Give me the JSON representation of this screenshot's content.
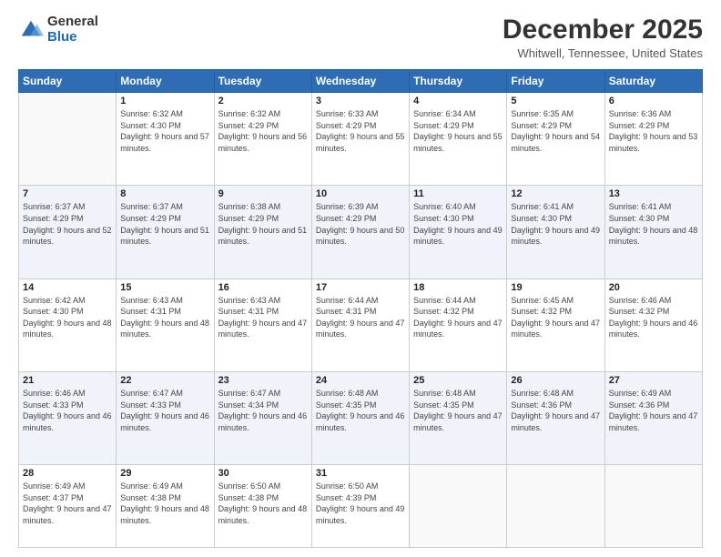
{
  "header": {
    "logo_general": "General",
    "logo_blue": "Blue",
    "month_title": "December 2025",
    "location": "Whitwell, Tennessee, United States"
  },
  "days_of_week": [
    "Sunday",
    "Monday",
    "Tuesday",
    "Wednesday",
    "Thursday",
    "Friday",
    "Saturday"
  ],
  "weeks": [
    [
      {
        "day": "",
        "sunrise": "",
        "sunset": "",
        "daylight": "",
        "empty": true
      },
      {
        "day": "1",
        "sunrise": "Sunrise: 6:32 AM",
        "sunset": "Sunset: 4:30 PM",
        "daylight": "Daylight: 9 hours and 57 minutes."
      },
      {
        "day": "2",
        "sunrise": "Sunrise: 6:32 AM",
        "sunset": "Sunset: 4:29 PM",
        "daylight": "Daylight: 9 hours and 56 minutes."
      },
      {
        "day": "3",
        "sunrise": "Sunrise: 6:33 AM",
        "sunset": "Sunset: 4:29 PM",
        "daylight": "Daylight: 9 hours and 55 minutes."
      },
      {
        "day": "4",
        "sunrise": "Sunrise: 6:34 AM",
        "sunset": "Sunset: 4:29 PM",
        "daylight": "Daylight: 9 hours and 55 minutes."
      },
      {
        "day": "5",
        "sunrise": "Sunrise: 6:35 AM",
        "sunset": "Sunset: 4:29 PM",
        "daylight": "Daylight: 9 hours and 54 minutes."
      },
      {
        "day": "6",
        "sunrise": "Sunrise: 6:36 AM",
        "sunset": "Sunset: 4:29 PM",
        "daylight": "Daylight: 9 hours and 53 minutes."
      }
    ],
    [
      {
        "day": "7",
        "sunrise": "Sunrise: 6:37 AM",
        "sunset": "Sunset: 4:29 PM",
        "daylight": "Daylight: 9 hours and 52 minutes."
      },
      {
        "day": "8",
        "sunrise": "Sunrise: 6:37 AM",
        "sunset": "Sunset: 4:29 PM",
        "daylight": "Daylight: 9 hours and 51 minutes."
      },
      {
        "day": "9",
        "sunrise": "Sunrise: 6:38 AM",
        "sunset": "Sunset: 4:29 PM",
        "daylight": "Daylight: 9 hours and 51 minutes."
      },
      {
        "day": "10",
        "sunrise": "Sunrise: 6:39 AM",
        "sunset": "Sunset: 4:29 PM",
        "daylight": "Daylight: 9 hours and 50 minutes."
      },
      {
        "day": "11",
        "sunrise": "Sunrise: 6:40 AM",
        "sunset": "Sunset: 4:30 PM",
        "daylight": "Daylight: 9 hours and 49 minutes."
      },
      {
        "day": "12",
        "sunrise": "Sunrise: 6:41 AM",
        "sunset": "Sunset: 4:30 PM",
        "daylight": "Daylight: 9 hours and 49 minutes."
      },
      {
        "day": "13",
        "sunrise": "Sunrise: 6:41 AM",
        "sunset": "Sunset: 4:30 PM",
        "daylight": "Daylight: 9 hours and 48 minutes."
      }
    ],
    [
      {
        "day": "14",
        "sunrise": "Sunrise: 6:42 AM",
        "sunset": "Sunset: 4:30 PM",
        "daylight": "Daylight: 9 hours and 48 minutes."
      },
      {
        "day": "15",
        "sunrise": "Sunrise: 6:43 AM",
        "sunset": "Sunset: 4:31 PM",
        "daylight": "Daylight: 9 hours and 48 minutes."
      },
      {
        "day": "16",
        "sunrise": "Sunrise: 6:43 AM",
        "sunset": "Sunset: 4:31 PM",
        "daylight": "Daylight: 9 hours and 47 minutes."
      },
      {
        "day": "17",
        "sunrise": "Sunrise: 6:44 AM",
        "sunset": "Sunset: 4:31 PM",
        "daylight": "Daylight: 9 hours and 47 minutes."
      },
      {
        "day": "18",
        "sunrise": "Sunrise: 6:44 AM",
        "sunset": "Sunset: 4:32 PM",
        "daylight": "Daylight: 9 hours and 47 minutes."
      },
      {
        "day": "19",
        "sunrise": "Sunrise: 6:45 AM",
        "sunset": "Sunset: 4:32 PM",
        "daylight": "Daylight: 9 hours and 47 minutes."
      },
      {
        "day": "20",
        "sunrise": "Sunrise: 6:46 AM",
        "sunset": "Sunset: 4:32 PM",
        "daylight": "Daylight: 9 hours and 46 minutes."
      }
    ],
    [
      {
        "day": "21",
        "sunrise": "Sunrise: 6:46 AM",
        "sunset": "Sunset: 4:33 PM",
        "daylight": "Daylight: 9 hours and 46 minutes."
      },
      {
        "day": "22",
        "sunrise": "Sunrise: 6:47 AM",
        "sunset": "Sunset: 4:33 PM",
        "daylight": "Daylight: 9 hours and 46 minutes."
      },
      {
        "day": "23",
        "sunrise": "Sunrise: 6:47 AM",
        "sunset": "Sunset: 4:34 PM",
        "daylight": "Daylight: 9 hours and 46 minutes."
      },
      {
        "day": "24",
        "sunrise": "Sunrise: 6:48 AM",
        "sunset": "Sunset: 4:35 PM",
        "daylight": "Daylight: 9 hours and 46 minutes."
      },
      {
        "day": "25",
        "sunrise": "Sunrise: 6:48 AM",
        "sunset": "Sunset: 4:35 PM",
        "daylight": "Daylight: 9 hours and 47 minutes."
      },
      {
        "day": "26",
        "sunrise": "Sunrise: 6:48 AM",
        "sunset": "Sunset: 4:36 PM",
        "daylight": "Daylight: 9 hours and 47 minutes."
      },
      {
        "day": "27",
        "sunrise": "Sunrise: 6:49 AM",
        "sunset": "Sunset: 4:36 PM",
        "daylight": "Daylight: 9 hours and 47 minutes."
      }
    ],
    [
      {
        "day": "28",
        "sunrise": "Sunrise: 6:49 AM",
        "sunset": "Sunset: 4:37 PM",
        "daylight": "Daylight: 9 hours and 47 minutes."
      },
      {
        "day": "29",
        "sunrise": "Sunrise: 6:49 AM",
        "sunset": "Sunset: 4:38 PM",
        "daylight": "Daylight: 9 hours and 48 minutes."
      },
      {
        "day": "30",
        "sunrise": "Sunrise: 6:50 AM",
        "sunset": "Sunset: 4:38 PM",
        "daylight": "Daylight: 9 hours and 48 minutes."
      },
      {
        "day": "31",
        "sunrise": "Sunrise: 6:50 AM",
        "sunset": "Sunset: 4:39 PM",
        "daylight": "Daylight: 9 hours and 49 minutes."
      },
      {
        "day": "",
        "sunrise": "",
        "sunset": "",
        "daylight": "",
        "empty": true
      },
      {
        "day": "",
        "sunrise": "",
        "sunset": "",
        "daylight": "",
        "empty": true
      },
      {
        "day": "",
        "sunrise": "",
        "sunset": "",
        "daylight": "",
        "empty": true
      }
    ]
  ]
}
